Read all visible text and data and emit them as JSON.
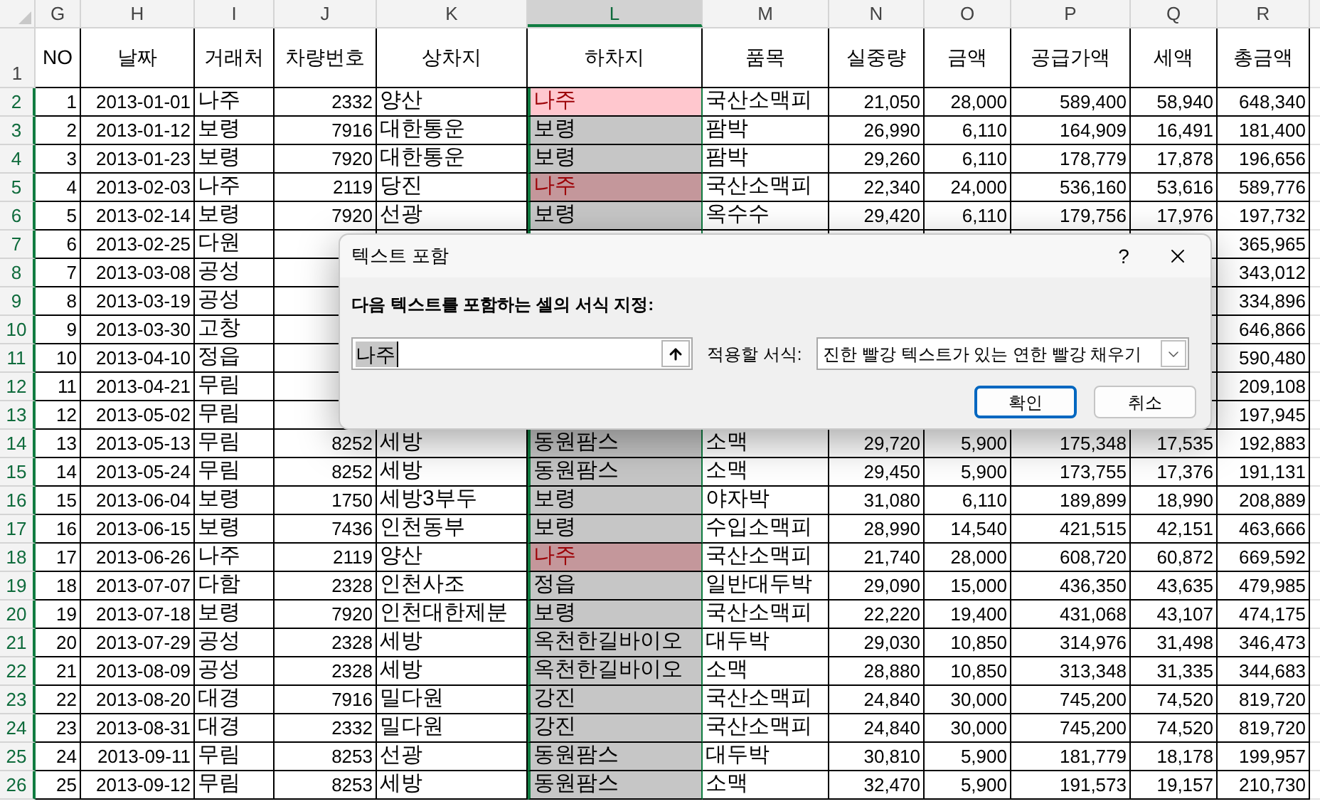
{
  "column_headers": [
    {
      "label": "G",
      "selected": false
    },
    {
      "label": "H",
      "selected": false
    },
    {
      "label": "I",
      "selected": false
    },
    {
      "label": "J",
      "selected": false
    },
    {
      "label": "K",
      "selected": false
    },
    {
      "label": "L",
      "selected": true
    },
    {
      "label": "M",
      "selected": false
    },
    {
      "label": "N",
      "selected": false
    },
    {
      "label": "O",
      "selected": false
    },
    {
      "label": "P",
      "selected": false
    },
    {
      "label": "Q",
      "selected": false
    },
    {
      "label": "R",
      "selected": false
    }
  ],
  "header_row": {
    "label": "1",
    "selected": false,
    "cells": [
      "NO",
      "날짜",
      "거래처",
      "차량번호",
      "상차지",
      "하차지",
      "품목",
      "실중량",
      "금액",
      "공급가액",
      "세액",
      "총금액"
    ]
  },
  "rows": [
    {
      "label": "2",
      "selected": true,
      "match": true,
      "active": true,
      "cells": {
        "G": "1",
        "H": "2013-01-01",
        "I": "나주",
        "J": "2332",
        "K": "양산",
        "L": "나주",
        "M": "국산소맥피",
        "N": "21,050",
        "O": "28,000",
        "P": "589,400",
        "Q": "58,940",
        "R": "648,340"
      }
    },
    {
      "label": "3",
      "selected": true,
      "match": false,
      "active": false,
      "cells": {
        "G": "2",
        "H": "2013-01-12",
        "I": "보령",
        "J": "7916",
        "K": "대한통운",
        "L": "보령",
        "M": "팜박",
        "N": "26,990",
        "O": "6,110",
        "P": "164,909",
        "Q": "16,491",
        "R": "181,400"
      }
    },
    {
      "label": "4",
      "selected": true,
      "match": false,
      "active": false,
      "cells": {
        "G": "3",
        "H": "2013-01-23",
        "I": "보령",
        "J": "7920",
        "K": "대한통운",
        "L": "보령",
        "M": "팜박",
        "N": "29,260",
        "O": "6,110",
        "P": "178,779",
        "Q": "17,878",
        "R": "196,656"
      }
    },
    {
      "label": "5",
      "selected": true,
      "match": true,
      "active": false,
      "cells": {
        "G": "4",
        "H": "2013-02-03",
        "I": "나주",
        "J": "2119",
        "K": "당진",
        "L": "나주",
        "M": "국산소맥피",
        "N": "22,340",
        "O": "24,000",
        "P": "536,160",
        "Q": "53,616",
        "R": "589,776"
      }
    },
    {
      "label": "6",
      "selected": true,
      "match": false,
      "active": false,
      "cells": {
        "G": "5",
        "H": "2013-02-14",
        "I": "보령",
        "J": "7920",
        "K": "선광",
        "L": "보령",
        "M": "옥수수",
        "N": "29,420",
        "O": "6,110",
        "P": "179,756",
        "Q": "17,976",
        "R": "197,732"
      }
    },
    {
      "label": "7",
      "selected": true,
      "cells": {
        "G": "6",
        "H": "2013-02-25",
        "I": "다원",
        "R": "365,965"
      }
    },
    {
      "label": "8",
      "selected": true,
      "cells": {
        "G": "7",
        "H": "2013-03-08",
        "I": "공성",
        "R": "343,012"
      }
    },
    {
      "label": "9",
      "selected": true,
      "cells": {
        "G": "8",
        "H": "2013-03-19",
        "I": "공성",
        "R": "334,896"
      }
    },
    {
      "label": "10",
      "selected": true,
      "cells": {
        "G": "9",
        "H": "2013-03-30",
        "I": "고창",
        "R": "646,866"
      }
    },
    {
      "label": "11",
      "selected": true,
      "cells": {
        "G": "10",
        "H": "2013-04-10",
        "I": "정읍",
        "R": "590,480"
      }
    },
    {
      "label": "12",
      "selected": true,
      "cells": {
        "G": "11",
        "H": "2013-04-21",
        "I": "무림",
        "R": "209,108"
      }
    },
    {
      "label": "13",
      "selected": true,
      "cells": {
        "G": "12",
        "H": "2013-05-02",
        "I": "무림",
        "R": "197,945"
      }
    },
    {
      "label": "14",
      "selected": true,
      "match": false,
      "active": false,
      "cells": {
        "G": "13",
        "H": "2013-05-13",
        "I": "무림",
        "J": "8252",
        "K": "세방",
        "L": "동원팜스",
        "M": "소맥",
        "N": "29,720",
        "O": "5,900",
        "P": "175,348",
        "Q": "17,535",
        "R": "192,883"
      }
    },
    {
      "label": "15",
      "selected": true,
      "match": false,
      "active": false,
      "cells": {
        "G": "14",
        "H": "2013-05-24",
        "I": "무림",
        "J": "8252",
        "K": "세방",
        "L": "동원팜스",
        "M": "소맥",
        "N": "29,450",
        "O": "5,900",
        "P": "173,755",
        "Q": "17,376",
        "R": "191,131"
      }
    },
    {
      "label": "16",
      "selected": true,
      "match": false,
      "active": false,
      "cells": {
        "G": "15",
        "H": "2013-06-04",
        "I": "보령",
        "J": "1750",
        "K": "세방3부두",
        "L": "보령",
        "M": "야자박",
        "N": "31,080",
        "O": "6,110",
        "P": "189,899",
        "Q": "18,990",
        "R": "208,889"
      }
    },
    {
      "label": "17",
      "selected": true,
      "match": false,
      "active": false,
      "cells": {
        "G": "16",
        "H": "2013-06-15",
        "I": "보령",
        "J": "7436",
        "K": "인천동부",
        "L": "보령",
        "M": "수입소맥피",
        "N": "28,990",
        "O": "14,540",
        "P": "421,515",
        "Q": "42,151",
        "R": "463,666"
      }
    },
    {
      "label": "18",
      "selected": true,
      "match": true,
      "active": false,
      "cells": {
        "G": "17",
        "H": "2013-06-26",
        "I": "나주",
        "J": "2119",
        "K": "양산",
        "L": "나주",
        "M": "국산소맥피",
        "N": "21,740",
        "O": "28,000",
        "P": "608,720",
        "Q": "60,872",
        "R": "669,592"
      }
    },
    {
      "label": "19",
      "selected": true,
      "match": false,
      "active": false,
      "cells": {
        "G": "18",
        "H": "2013-07-07",
        "I": "다함",
        "J": "2328",
        "K": "인천사조",
        "L": "정읍",
        "M": "일반대두박",
        "N": "29,090",
        "O": "15,000",
        "P": "436,350",
        "Q": "43,635",
        "R": "479,985"
      }
    },
    {
      "label": "20",
      "selected": true,
      "match": false,
      "active": false,
      "cells": {
        "G": "19",
        "H": "2013-07-18",
        "I": "보령",
        "J": "7920",
        "K": "인천대한제분",
        "L": "보령",
        "M": "국산소맥피",
        "N": "22,220",
        "O": "19,400",
        "P": "431,068",
        "Q": "43,107",
        "R": "474,175"
      }
    },
    {
      "label": "21",
      "selected": true,
      "match": false,
      "active": false,
      "cells": {
        "G": "20",
        "H": "2013-07-29",
        "I": "공성",
        "J": "2328",
        "K": "세방",
        "L": "옥천한길바이오",
        "M": "대두박",
        "N": "29,030",
        "O": "10,850",
        "P": "314,976",
        "Q": "31,498",
        "R": "346,473"
      }
    },
    {
      "label": "22",
      "selected": true,
      "match": false,
      "active": false,
      "cells": {
        "G": "21",
        "H": "2013-08-09",
        "I": "공성",
        "J": "2328",
        "K": "세방",
        "L": "옥천한길바이오",
        "M": "소맥",
        "N": "28,880",
        "O": "10,850",
        "P": "313,348",
        "Q": "31,335",
        "R": "344,683"
      }
    },
    {
      "label": "23",
      "selected": true,
      "match": false,
      "active": false,
      "cells": {
        "G": "22",
        "H": "2013-08-20",
        "I": "대경",
        "J": "7916",
        "K": "밀다원",
        "L": "강진",
        "M": "국산소맥피",
        "N": "24,840",
        "O": "30,000",
        "P": "745,200",
        "Q": "74,520",
        "R": "819,720"
      }
    },
    {
      "label": "24",
      "selected": true,
      "match": false,
      "active": false,
      "cells": {
        "G": "23",
        "H": "2013-08-31",
        "I": "대경",
        "J": "2332",
        "K": "밀다원",
        "L": "강진",
        "M": "국산소맥피",
        "N": "24,840",
        "O": "30,000",
        "P": "745,200",
        "Q": "74,520",
        "R": "819,720"
      }
    },
    {
      "label": "25",
      "selected": true,
      "match": false,
      "active": false,
      "cells": {
        "G": "24",
        "H": "2013-09-11",
        "I": "무림",
        "J": "8253",
        "K": "선광",
        "L": "동원팜스",
        "M": "대두박",
        "N": "30,810",
        "O": "5,900",
        "P": "181,779",
        "Q": "18,178",
        "R": "199,957"
      }
    },
    {
      "label": "26",
      "selected": true,
      "match": false,
      "active": false,
      "cells": {
        "G": "25",
        "H": "2013-09-12",
        "I": "무림",
        "J": "8253",
        "K": "세방",
        "L": "동원팜스",
        "M": "소맥",
        "N": "32,470",
        "O": "5,900",
        "P": "191,573",
        "Q": "19,157",
        "R": "210,730"
      }
    }
  ],
  "dialog": {
    "title": "텍스트 포함",
    "help": "?",
    "prompt": "다음 텍스트를 포함하는 셀의 서식 지정:",
    "value": "나주",
    "format_label": "적용할 서식:",
    "format_value": "진한 빨강 텍스트가 있는 연한 빨강 채우기",
    "ok": "확인",
    "cancel": "취소"
  }
}
